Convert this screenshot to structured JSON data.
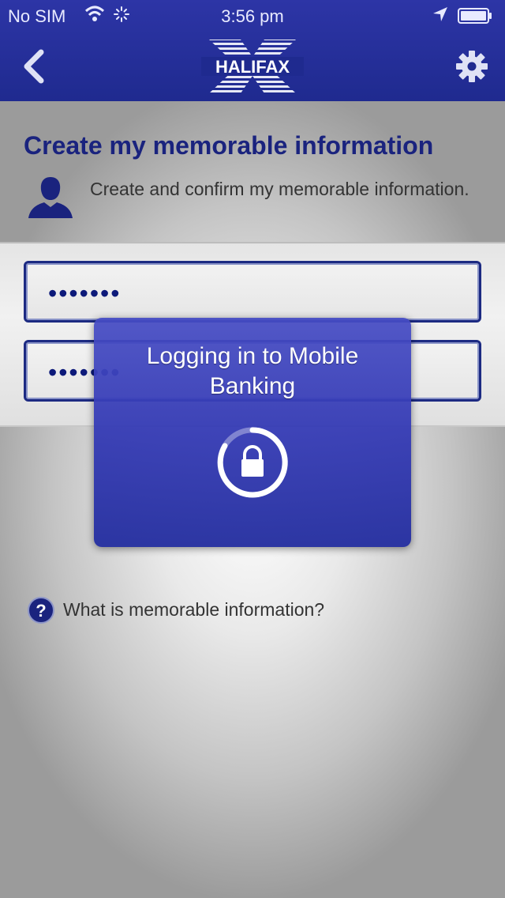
{
  "status_bar": {
    "carrier": "No SIM",
    "time": "3:56 pm",
    "icons": [
      "wifi-icon",
      "activity-spinner-icon",
      "location-arrow-icon",
      "battery-icon"
    ]
  },
  "nav": {
    "back_icon": "chevron-left-icon",
    "logo_text": "HALIFAX",
    "settings_icon": "gear-icon"
  },
  "page": {
    "title": "Create my memorable information",
    "subtitle": "Create and confirm my memorable information.",
    "avatar_icon": "user-silhouette-icon"
  },
  "form": {
    "memorable_info_value": "•••••••",
    "confirm_value": "•••••••"
  },
  "help": {
    "icon": "question-icon",
    "label": "What is memorable information?"
  },
  "loading_dialog": {
    "message": "Logging in to Mobile Banking",
    "icon": "lock-icon"
  },
  "colors": {
    "brand_blue": "#1f2a8f",
    "title_navy": "#1a237e",
    "dialog_blue": "#3a40b6"
  }
}
